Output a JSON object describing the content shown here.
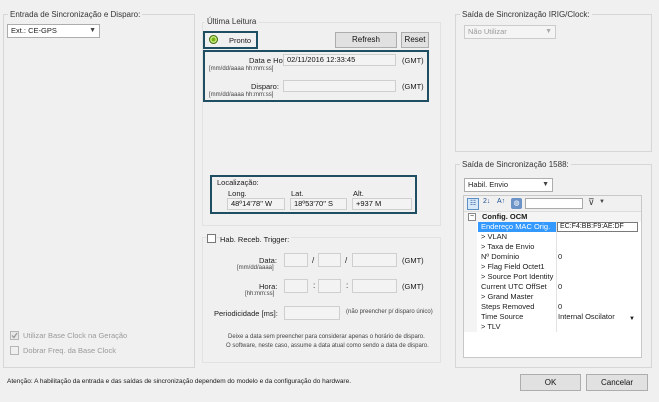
{
  "input_group": {
    "title": "Entrada de Sincronização e Disparo:",
    "source_value": "Ext.: CE-GPS",
    "use_base_clock_label": "Utilizar Base Clock na Geração",
    "double_freq_label": "Dobrar Freq. da Base Clock"
  },
  "last_reading": {
    "title": "Última Leitura",
    "status_label": "Pronto",
    "refresh_label": "Refresh",
    "reset_label": "Reset",
    "datetime_label": "Data e Hora:",
    "datetime_format": "[mm/dd/aaaa hh:mm:ss]",
    "datetime_value": "02/11/2016 12:33:45",
    "datetime_tz": "(GMT)",
    "trigger_label": "Disparo:",
    "trigger_format": "[mm/dd/aaaa hh:mm:ss]",
    "trigger_value": "",
    "trigger_tz": "(GMT)",
    "location_label": "Localização:",
    "long_label": "Long.",
    "lat_label": "Lat.",
    "alt_label": "Alt.",
    "long_value": "48º14'78\" W",
    "lat_value": "18º53'70\" S",
    "alt_value": "+937 M"
  },
  "trigger_group": {
    "enable_label": "Hab. Receb. Trigger:",
    "date_label": "Data:",
    "date_format": "[mm/dd/aaaa]",
    "date_sep": "/",
    "date_tz": "(GMT)",
    "time_label": "Hora:",
    "time_format": "[hh:mm:ss]",
    "time_sep": ":",
    "time_tz": "(GMT)",
    "period_label": "Periodicidade [ms]:",
    "period_note": "(não preencher p/ disparo único)",
    "note_line1": "Deixe a data sem preencher para considerar apenas o horário de disparo.",
    "note_line2": "O software, neste caso, assume a data atual como sendo a data de disparo."
  },
  "irig_group": {
    "title": "Saída de Sincronização IRIG/Clock:",
    "value": "Não Utilizar"
  },
  "ptp_group": {
    "title": "Saída de Sincronização 1588:",
    "enable_value": "Habil. Envio",
    "grid": {
      "category": "Config. OCM",
      "rows": [
        {
          "key": "Endereço MAC Orig.",
          "value": "EC:F4:BB:F9:AE:DF",
          "selected": true
        },
        {
          "key": "> VLAN",
          "value": ""
        },
        {
          "key": "> Taxa de Envio",
          "value": ""
        },
        {
          "key": "Nº Domínio",
          "value": "0"
        },
        {
          "key": "> Flag Field Octet1",
          "value": ""
        },
        {
          "key": "> Source Port Identity",
          "value": ""
        },
        {
          "key": "Current UTC OffSet",
          "value": "0"
        },
        {
          "key": "> Grand Master",
          "value": ""
        },
        {
          "key": "Steps Removed",
          "value": "0"
        },
        {
          "key": "Time Source",
          "value": "Internal Oscilator"
        },
        {
          "key": "> TLV",
          "value": ""
        }
      ]
    }
  },
  "footer": {
    "note": "Atenção: A habilitação da entrada e das saídas de sincronização dependem do modelo e da configuração do hardware.",
    "ok_label": "OK",
    "cancel_label": "Cancelar"
  },
  "colors": {
    "highlight": "#1f4e63",
    "status_ok": "#7ab317",
    "selection": "#3399ff"
  }
}
